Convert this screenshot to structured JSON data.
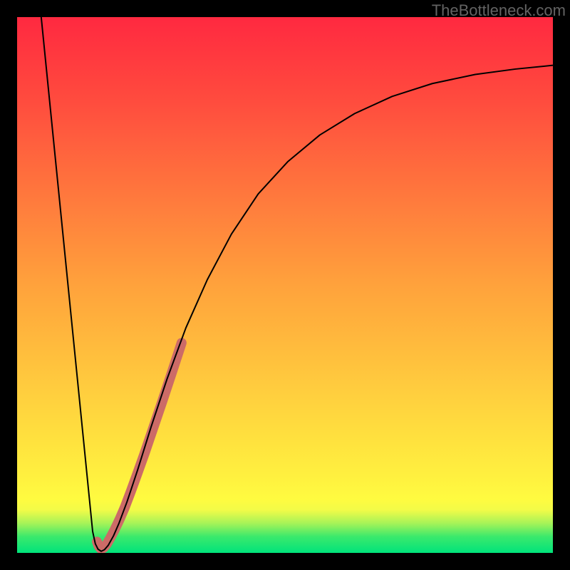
{
  "watermark": "TheBottleneck.com",
  "chart_data": {
    "type": "line",
    "title": "",
    "xlabel": "",
    "ylabel": "",
    "xlim": [
      0,
      100
    ],
    "ylim": [
      0,
      100
    ],
    "gradient_stops": [
      {
        "offset": 0.0,
        "color": "#00e37b"
      },
      {
        "offset": 0.03,
        "color": "#3ae96c"
      },
      {
        "offset": 0.055,
        "color": "#a5f358"
      },
      {
        "offset": 0.08,
        "color": "#f2fb48"
      },
      {
        "offset": 0.1,
        "color": "#fffb40"
      },
      {
        "offset": 0.14,
        "color": "#fff13f"
      },
      {
        "offset": 0.5,
        "color": "#ffa23c"
      },
      {
        "offset": 0.85,
        "color": "#ff4a3e"
      },
      {
        "offset": 1.0,
        "color": "#ff2940"
      }
    ],
    "series": [
      {
        "name": "curve-black",
        "stroke": "#000000",
        "stroke_width": 2,
        "points": [
          {
            "x": 4.5,
            "y": 100.0
          },
          {
            "x": 5.8,
            "y": 87.0
          },
          {
            "x": 7.1,
            "y": 74.0
          },
          {
            "x": 8.4,
            "y": 61.0
          },
          {
            "x": 9.7,
            "y": 48.0
          },
          {
            "x": 11.0,
            "y": 35.0
          },
          {
            "x": 12.3,
            "y": 22.0
          },
          {
            "x": 13.6,
            "y": 9.0
          },
          {
            "x": 14.1,
            "y": 4.0
          },
          {
            "x": 14.6,
            "y": 1.7
          },
          {
            "x": 15.1,
            "y": 0.7
          },
          {
            "x": 15.7,
            "y": 0.3
          },
          {
            "x": 16.3,
            "y": 0.6
          },
          {
            "x": 17.0,
            "y": 1.4
          },
          {
            "x": 18.0,
            "y": 3.2
          },
          {
            "x": 19.0,
            "y": 5.5
          },
          {
            "x": 20.5,
            "y": 9.5
          },
          {
            "x": 22.5,
            "y": 15.5
          },
          {
            "x": 25.0,
            "y": 23.5
          },
          {
            "x": 28.0,
            "y": 32.5
          },
          {
            "x": 31.5,
            "y": 42.0
          },
          {
            "x": 35.5,
            "y": 51.0
          },
          {
            "x": 40.0,
            "y": 59.5
          },
          {
            "x": 45.0,
            "y": 67.0
          },
          {
            "x": 50.5,
            "y": 73.0
          },
          {
            "x": 56.5,
            "y": 78.0
          },
          {
            "x": 63.0,
            "y": 82.0
          },
          {
            "x": 70.0,
            "y": 85.2
          },
          {
            "x": 77.5,
            "y": 87.6
          },
          {
            "x": 85.5,
            "y": 89.3
          },
          {
            "x": 93.0,
            "y": 90.3
          },
          {
            "x": 100.0,
            "y": 91.0
          }
        ]
      },
      {
        "name": "overlay-salmon",
        "stroke": "#cc6b67",
        "stroke_width": 14,
        "linecap": "round",
        "points": [
          {
            "x": 14.9,
            "y": 2.1
          },
          {
            "x": 15.2,
            "y": 1.3
          },
          {
            "x": 15.6,
            "y": 0.8
          },
          {
            "x": 16.1,
            "y": 0.9
          },
          {
            "x": 16.7,
            "y": 1.6
          },
          {
            "x": 17.4,
            "y": 2.8
          },
          {
            "x": 18.2,
            "y": 4.3
          },
          {
            "x": 19.1,
            "y": 6.2
          },
          {
            "x": 20.1,
            "y": 8.5
          },
          {
            "x": 21.2,
            "y": 11.4
          },
          {
            "x": 22.4,
            "y": 14.7
          },
          {
            "x": 23.8,
            "y": 18.6
          },
          {
            "x": 25.3,
            "y": 23.0
          },
          {
            "x": 27.0,
            "y": 28.0
          },
          {
            "x": 28.8,
            "y": 33.4
          },
          {
            "x": 30.7,
            "y": 39.2
          }
        ]
      }
    ]
  }
}
